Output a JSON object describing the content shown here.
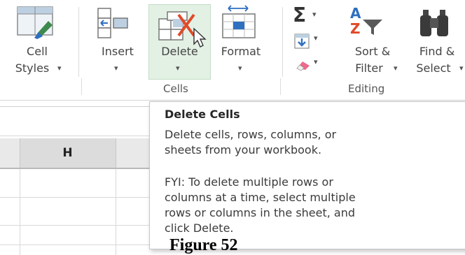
{
  "ribbon": {
    "buttons": {
      "cell_styles": {
        "line1": "Cell",
        "line2": "Styles"
      },
      "insert": {
        "label": "Insert"
      },
      "delete": {
        "label": "Delete"
      },
      "format": {
        "label": "Format"
      },
      "sort_filter": {
        "line1": "Sort &",
        "line2": "Filter"
      },
      "find_select": {
        "line1": "Find &",
        "line2": "Select"
      }
    },
    "groups": {
      "cells": "Cells",
      "editing": "Editing"
    }
  },
  "sheet": {
    "column_header": "H"
  },
  "tooltip": {
    "title": "Delete Cells",
    "description_lines": [
      "Delete cells, rows, columns, or",
      "sheets from your workbook."
    ],
    "fyi_lines": [
      "FYI: To delete multiple rows or",
      "columns at a time, select multiple",
      "rows or columns in the sheet, and",
      "click Delete."
    ]
  },
  "caption": "Figure 52",
  "colors": {
    "delete_x": "#e04a2a",
    "hover_highlight": "#e3f1e4",
    "selection_blue": "#2e6fc0",
    "excel_green": "#3d8a4d"
  }
}
